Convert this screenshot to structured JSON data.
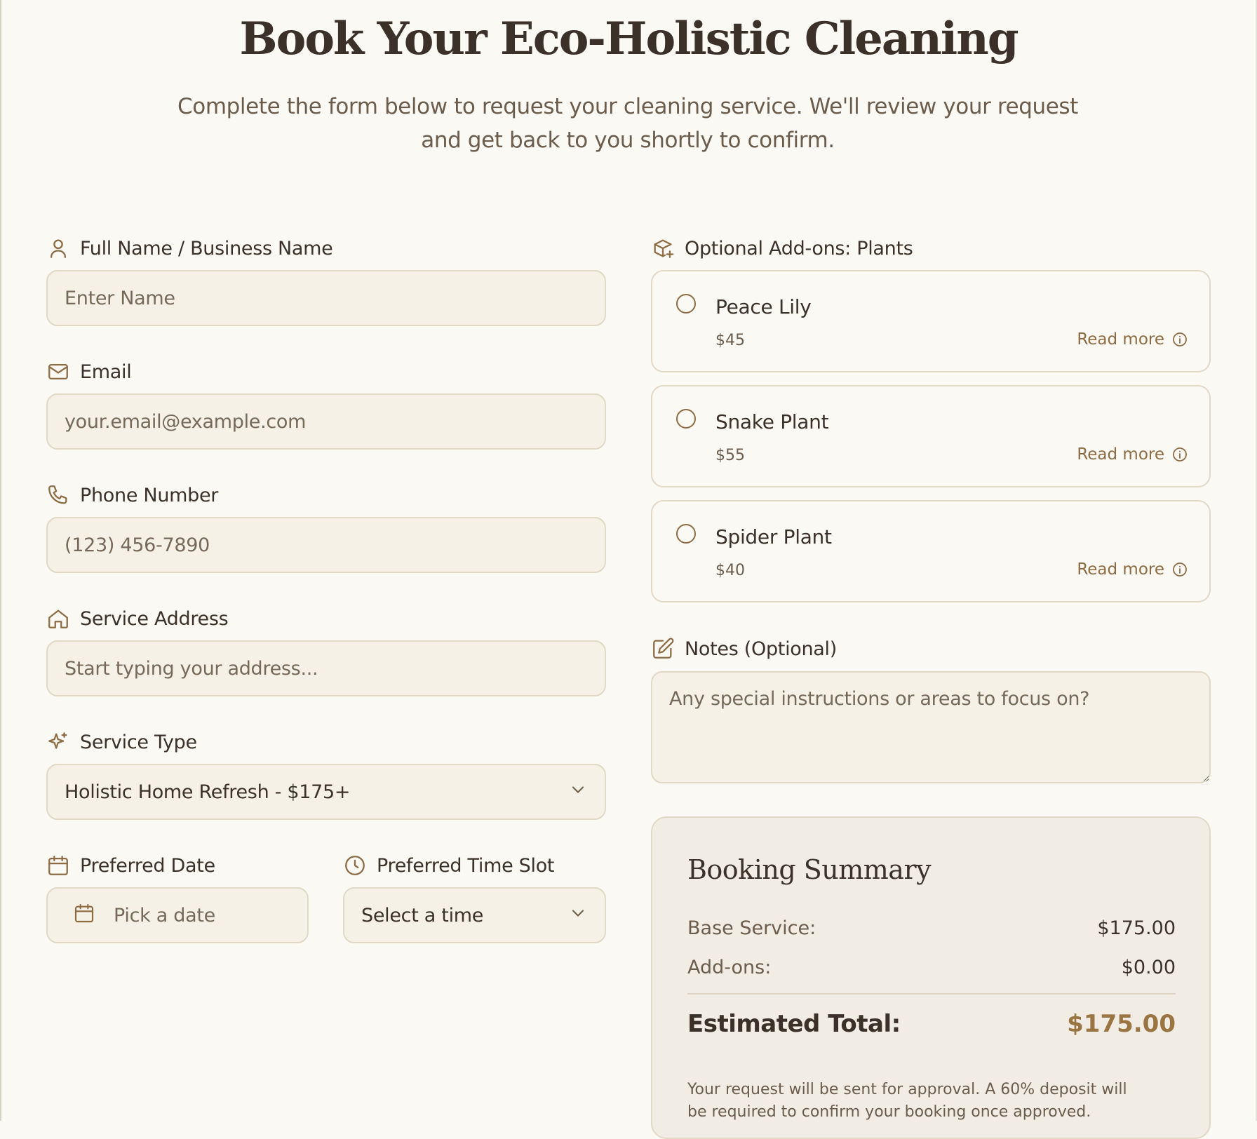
{
  "header": {
    "title": "Book Your Eco-Holistic Cleaning",
    "subtitle": "Complete the form below to request your cleaning service. We'll review your request and get back to you shortly to confirm."
  },
  "form": {
    "name": {
      "label": "Full Name / Business Name",
      "placeholder": "Enter Name",
      "icon": "user-icon"
    },
    "email": {
      "label": "Email",
      "placeholder": "your.email@example.com",
      "icon": "mail-icon"
    },
    "phone": {
      "label": "Phone Number",
      "placeholder": "(123) 456-7890",
      "icon": "phone-icon"
    },
    "address": {
      "label": "Service Address",
      "placeholder": "Start typing your address...",
      "icon": "home-icon"
    },
    "service_type": {
      "label": "Service Type",
      "value": "Holistic Home Refresh - $175+",
      "icon": "sparkles-icon"
    },
    "date": {
      "label": "Preferred Date",
      "placeholder": "Pick a date",
      "icon": "calendar-icon"
    },
    "time": {
      "label": "Preferred Time Slot",
      "placeholder": "Select a time",
      "icon": "clock-icon"
    }
  },
  "addons": {
    "label": "Optional Add-ons: Plants",
    "icon": "package-plus-icon",
    "read_more": "Read more",
    "items": [
      {
        "name": "Peace Lily",
        "price": "$45",
        "selected": false
      },
      {
        "name": "Snake Plant",
        "price": "$55",
        "selected": false
      },
      {
        "name": "Spider Plant",
        "price": "$40",
        "selected": false
      }
    ]
  },
  "notes": {
    "label": "Notes (Optional)",
    "placeholder": "Any special instructions or areas to focus on?",
    "icon": "edit-icon"
  },
  "summary": {
    "title": "Booking Summary",
    "base_label": "Base Service:",
    "base_value": "$175.00",
    "addons_label": "Add-ons:",
    "addons_value": "$0.00",
    "total_label": "Estimated Total:",
    "total_value": "$175.00",
    "note": "Your request will be sent for approval. A 60% deposit will be required to confirm your booking once approved."
  },
  "colors": {
    "background": "#fbf9f4",
    "field_background": "#f6f1e6",
    "border": "#e2d8c6",
    "accent": "#8d6b43",
    "total": "#9a7441",
    "text": "#3b3128"
  }
}
